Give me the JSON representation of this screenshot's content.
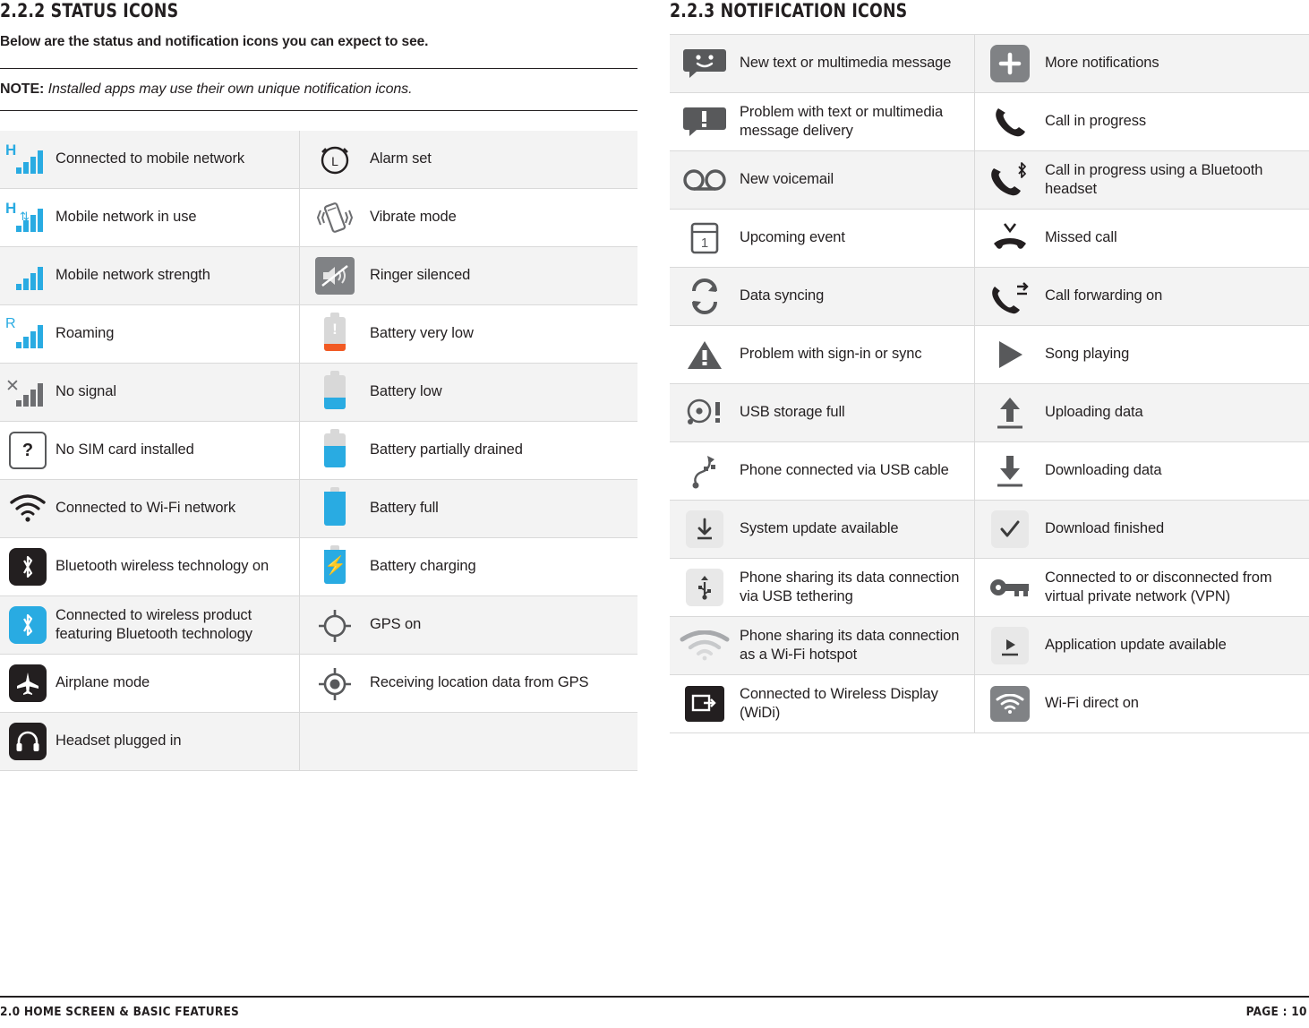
{
  "footer": {
    "left": "2.0 HOME SCREEN & BASIC FEATURES",
    "right": "PAGE : 10"
  },
  "left_section": {
    "title": "2.2.2 STATUS ICONS",
    "lead": "Below are the status and notification icons you can expect to see.",
    "note_label": "NOTE:",
    "note_text": " Installed apps may use their own unique notification icons.",
    "rows": [
      {
        "icon_a": "signal-h-icon",
        "text_a": "Connected to mobile network",
        "icon_b": "alarm-clock-icon",
        "text_b": "Alarm set"
      },
      {
        "icon_a": "signal-h-active-icon",
        "text_a": "Mobile network in use",
        "icon_b": "vibrate-icon",
        "text_b": "Vibrate mode"
      },
      {
        "icon_a": "signal-strength-icon",
        "text_a": "Mobile network strength",
        "icon_b": "ringer-silenced-icon",
        "text_b": "Ringer silenced"
      },
      {
        "icon_a": "roaming-icon",
        "text_a": "Roaming",
        "icon_b": "battery-very-low-icon",
        "text_b": "Battery very low"
      },
      {
        "icon_a": "no-signal-icon",
        "text_a": "No signal",
        "icon_b": "battery-low-icon",
        "text_b": "Battery low"
      },
      {
        "icon_a": "no-sim-icon",
        "text_a": "No SIM card installed",
        "icon_b": "battery-partial-icon",
        "text_b": "Battery partially drained"
      },
      {
        "icon_a": "wifi-icon",
        "text_a": "Connected to Wi-Fi network",
        "icon_b": "battery-full-icon",
        "text_b": "Battery full"
      },
      {
        "icon_a": "bluetooth-on-icon",
        "text_a": "Bluetooth wireless technology on",
        "icon_b": "battery-charging-icon",
        "text_b": "Battery charging"
      },
      {
        "icon_a": "bluetooth-connected-icon",
        "text_a": "Connected to wireless product featuring Bluetooth technology",
        "icon_b": "gps-on-icon",
        "text_b": "GPS on"
      },
      {
        "icon_a": "airplane-mode-icon",
        "text_a": "Airplane mode",
        "icon_b": "gps-receiving-icon",
        "text_b": "Receiving location data from GPS"
      },
      {
        "icon_a": "headset-icon",
        "text_a": "Headset plugged in",
        "icon_b": "",
        "text_b": ""
      }
    ]
  },
  "right_section": {
    "title": "2.2.3 NOTIFICATION ICONS",
    "rows": [
      {
        "icon_a": "new-message-icon",
        "text_a": "New text or multimedia message",
        "icon_b": "more-notifications-icon",
        "text_b": "More notifications"
      },
      {
        "icon_a": "message-problem-icon",
        "text_a": "Problem with text or multimedia message delivery",
        "icon_b": "call-in-progress-icon",
        "text_b": "Call in progress"
      },
      {
        "icon_a": "voicemail-icon",
        "text_a": "New voicemail",
        "icon_b": "call-bluetooth-icon",
        "text_b": "Call in progress using a Bluetooth headset"
      },
      {
        "icon_a": "calendar-event-icon",
        "text_a": "Upcoming event",
        "icon_b": "missed-call-icon",
        "text_b": "Missed call"
      },
      {
        "icon_a": "data-syncing-icon",
        "text_a": "Data syncing",
        "icon_b": "call-forwarding-icon",
        "text_b": "Call forwarding on"
      },
      {
        "icon_a": "sync-problem-icon",
        "text_a": "Problem with sign-in or sync",
        "icon_b": "song-playing-icon",
        "text_b": "Song playing"
      },
      {
        "icon_a": "usb-storage-full-icon",
        "text_a": "USB storage full",
        "icon_b": "uploading-data-icon",
        "text_b": "Uploading data"
      },
      {
        "icon_a": "usb-cable-icon",
        "text_a": "Phone connected via USB cable",
        "icon_b": "downloading-data-icon",
        "text_b": "Downloading data"
      },
      {
        "icon_a": "system-update-icon",
        "text_a": "System update available",
        "icon_b": "download-finished-icon",
        "text_b": "Download finished"
      },
      {
        "icon_a": "usb-tethering-icon",
        "text_a": "Phone sharing its data connection via USB tethering",
        "icon_b": "vpn-icon",
        "text_b": "Connected to or disconnected from virtual private network (VPN)"
      },
      {
        "icon_a": "wifi-hotspot-icon",
        "text_a": "Phone sharing its data connection as a Wi-Fi hotspot",
        "icon_b": "app-update-icon",
        "text_b": "Application update available"
      },
      {
        "icon_a": "wireless-display-icon",
        "text_a": "Connected to Wireless Display (WiDi)",
        "icon_b": "wifi-direct-icon",
        "text_b": "Wi-Fi direct on"
      }
    ]
  },
  "colors": {
    "accent": "#29abe2",
    "dark": "#231f20",
    "shade": "#f3f3f3",
    "rule": "#d9d9d9",
    "warn": "#f15a24"
  }
}
